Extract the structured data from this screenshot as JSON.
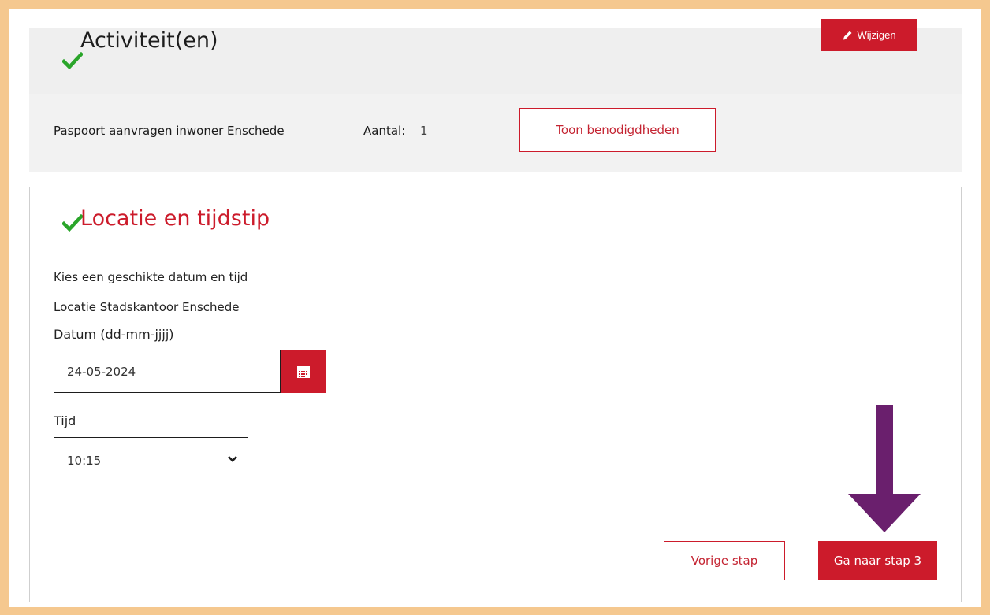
{
  "activities": {
    "title": "Activiteit(en)",
    "edit_label": "Wijzigen",
    "item_name": "Paspoort aanvragen inwoner Enschede",
    "count_label": "Aantal:",
    "count_value": "1",
    "requirements_button": "Toon benodigdheden"
  },
  "location": {
    "title": "Locatie en tijdstip",
    "instruction": "Kies een geschikte datum en tijd",
    "location_text": "Locatie Stadskantoor Enschede",
    "date_label": "Datum (dd-mm-jjjj)",
    "date_value": "24-05-2024",
    "time_label": "Tijd",
    "time_value": "10:15",
    "prev_button": "Vorige stap",
    "next_button": "Ga naar stap 3"
  },
  "colors": {
    "accent": "#cc1b2b",
    "check": "#2aa52a",
    "frame": "#f5c88f",
    "arrow": "#6a1f6d"
  },
  "icons": [
    "check-icon",
    "pencil-icon",
    "calendar-icon",
    "chevron-down-icon",
    "arrow-down-icon"
  ]
}
